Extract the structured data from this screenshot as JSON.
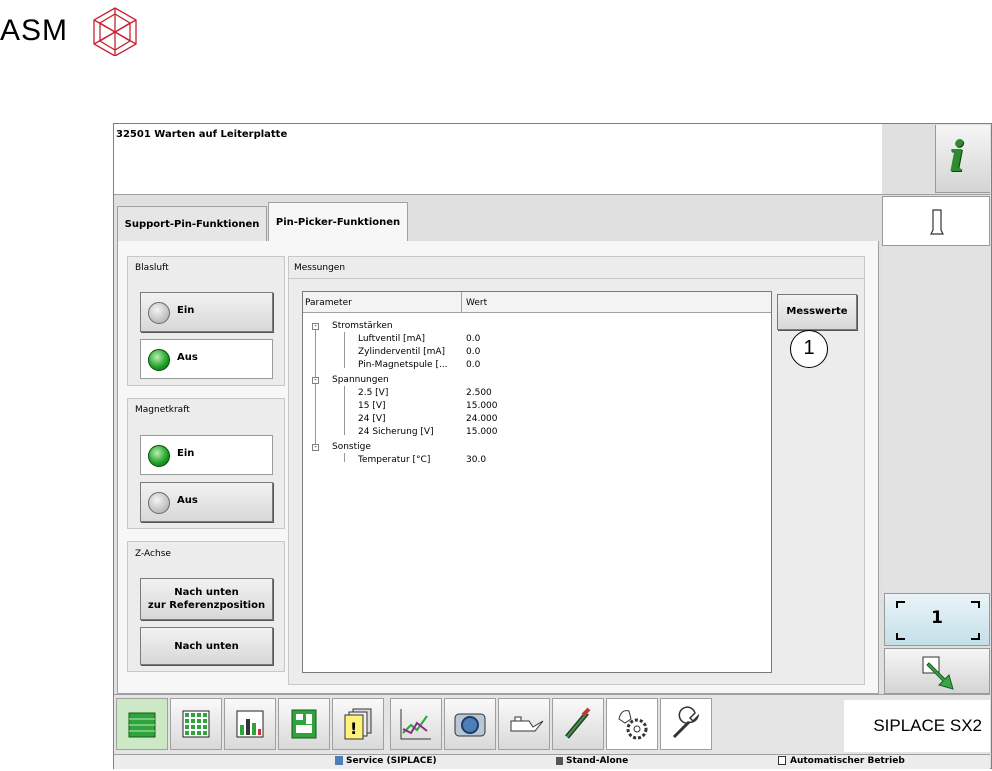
{
  "logo": {
    "text": "ASM"
  },
  "header": {
    "status_text": "32501 Warten auf Leiterplatte",
    "info_icon": "info-icon"
  },
  "tabs": [
    {
      "label": "Support-Pin-Funktionen",
      "active": false
    },
    {
      "label": "Pin-Picker-Funktionen",
      "active": true
    }
  ],
  "groups": {
    "blasluft": {
      "title": "Blasluft",
      "buttons": [
        {
          "label": "Ein",
          "state": "off"
        },
        {
          "label": "Aus",
          "state": "on"
        }
      ]
    },
    "magnetkraft": {
      "title": "Magnetkraft",
      "buttons": [
        {
          "label": "Ein",
          "state": "on"
        },
        {
          "label": "Aus",
          "state": "off"
        }
      ]
    },
    "zachse": {
      "title": "Z-Achse",
      "buttons": [
        {
          "label_line1": "Nach unten",
          "label_line2": "zur Referenzposition"
        },
        {
          "label": "Nach unten"
        }
      ]
    }
  },
  "messungen": {
    "title": "Messungen",
    "columns": [
      "Parameter",
      "Wert"
    ],
    "groups": [
      {
        "name": "Stromstärken",
        "items": [
          {
            "param": "Luftventil [mA]",
            "value": "0.0"
          },
          {
            "param": "Zylinderventil [mA]",
            "value": "0.0"
          },
          {
            "param": "Pin-Magnetspule [...",
            "value": "0.0"
          }
        ]
      },
      {
        "name": "Spannungen",
        "items": [
          {
            "param": "2.5 [V]",
            "value": "2.500"
          },
          {
            "param": "15 [V]",
            "value": "15.000"
          },
          {
            "param": "24 [V]",
            "value": "24.000"
          },
          {
            "param": "24 Sicherung [V]",
            "value": "15.000"
          }
        ]
      },
      {
        "name": "Sonstige",
        "items": [
          {
            "param": "Temperatur [°C]",
            "value": "30.0"
          }
        ]
      }
    ],
    "button_label": "Messwerte",
    "callout": "1"
  },
  "right_panel": {
    "counter": "1"
  },
  "toolbar": {
    "icons": [
      "feeder-icon",
      "grid-icon",
      "bar-chart-icon",
      "board-icon",
      "alert-icon",
      "line-chart-icon",
      "camera-icon",
      "oil-can-icon",
      "nozzle-icon",
      "service-gear-icon",
      "wrench-icon"
    ],
    "brand": "SIPLACE SX2"
  },
  "statusbar": {
    "user": "Service (SIPLACE)",
    "mode": "Stand-Alone",
    "operation": "Automatischer Betrieb"
  },
  "colors": {
    "led_on": "#23a52a",
    "accent_green": "#2e8b2e",
    "window_bg": "#e0e0e0"
  }
}
